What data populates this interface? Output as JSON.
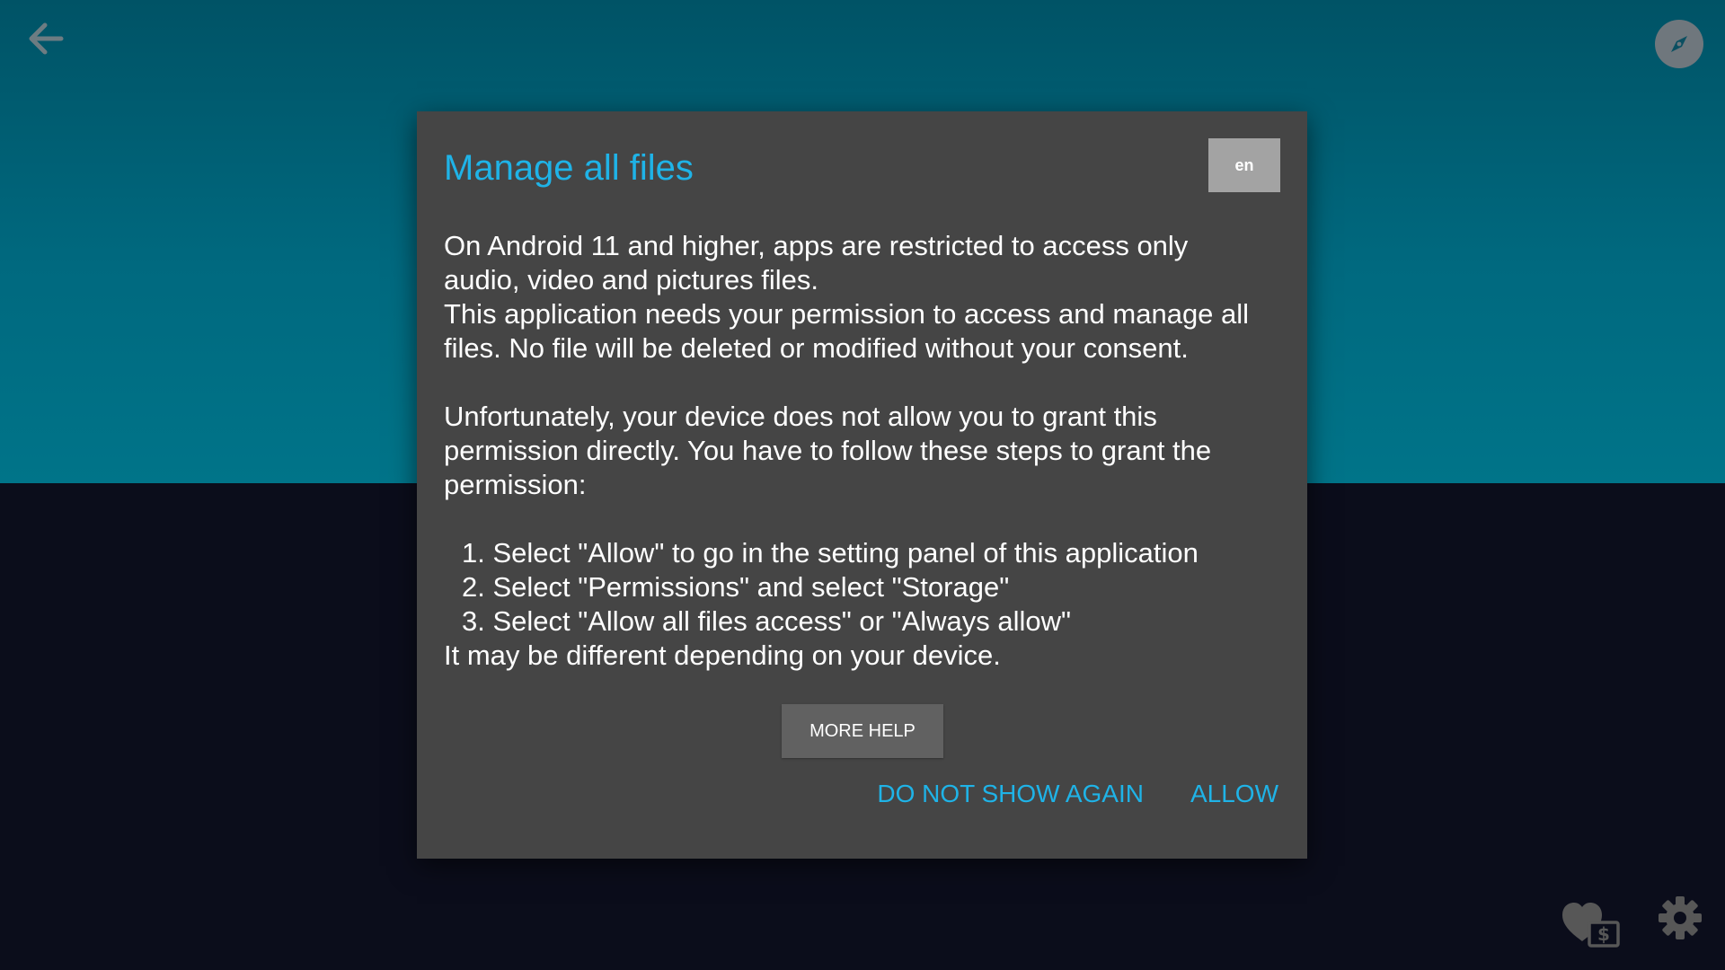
{
  "dialog": {
    "title": "Manage all files",
    "lang_label": "en",
    "body": {
      "intro_lines": [
        "On Android 11 and higher, apps are restricted to access only",
        "audio, video and pictures files.",
        "This application needs your permission to access and manage all",
        "files. No file will be deleted or modified without your consent."
      ],
      "explain_lines": [
        "Unfortunately, your device does not allow you to grant this",
        "permission directly. You have to follow these steps to grant the",
        "permission:"
      ],
      "steps": [
        "1. Select \"Allow\" to go in the setting panel of this application",
        "2. Select \"Permissions\" and select \"Storage\"",
        "3. Select \"Allow all files access\" or \"Always allow\""
      ],
      "note": "It may be different depending on your device."
    },
    "more_help_label": "MORE HELP",
    "actions": {
      "do_not_show_again": "DO NOT SHOW AGAIN",
      "allow": "ALLOW"
    }
  },
  "icons": {
    "back": "arrow-back-icon",
    "compass": "compass-icon",
    "donate": "heart-donate-icon",
    "settings": "gear-icon"
  },
  "colors": {
    "accent": "#1fb3e7",
    "dialog_background": "#454545",
    "top_band": "#00697f",
    "page_background": "#0b0d1b"
  }
}
